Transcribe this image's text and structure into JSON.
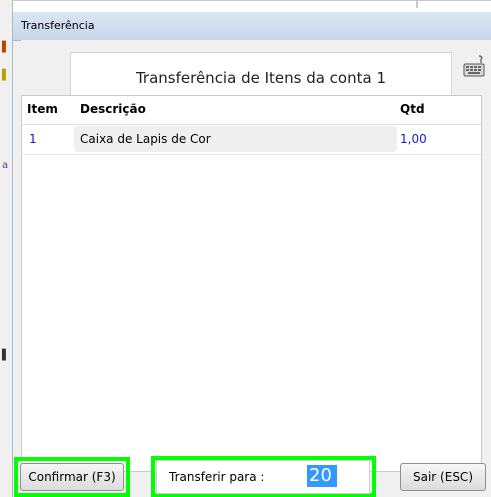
{
  "window": {
    "title": "Transferência"
  },
  "header": {
    "title": "Transferência de Itens da conta 1"
  },
  "icons": {
    "keyboard": "keyboard-icon"
  },
  "table": {
    "columns": [
      "Item",
      "Descrição",
      "Qtd"
    ],
    "rows": [
      {
        "item": "1",
        "descricao": "Caixa de Lapis de Cor",
        "qtd": "1,00"
      }
    ]
  },
  "footer": {
    "confirm_label": "Confirmar (F3)",
    "transfer_label": "Transferir para :",
    "transfer_value": "20",
    "exit_label": "Sair (ESC)"
  },
  "colors": {
    "highlight": "#00ff00",
    "selection": "#3399ff",
    "link_blue": "#1a1ac8"
  }
}
